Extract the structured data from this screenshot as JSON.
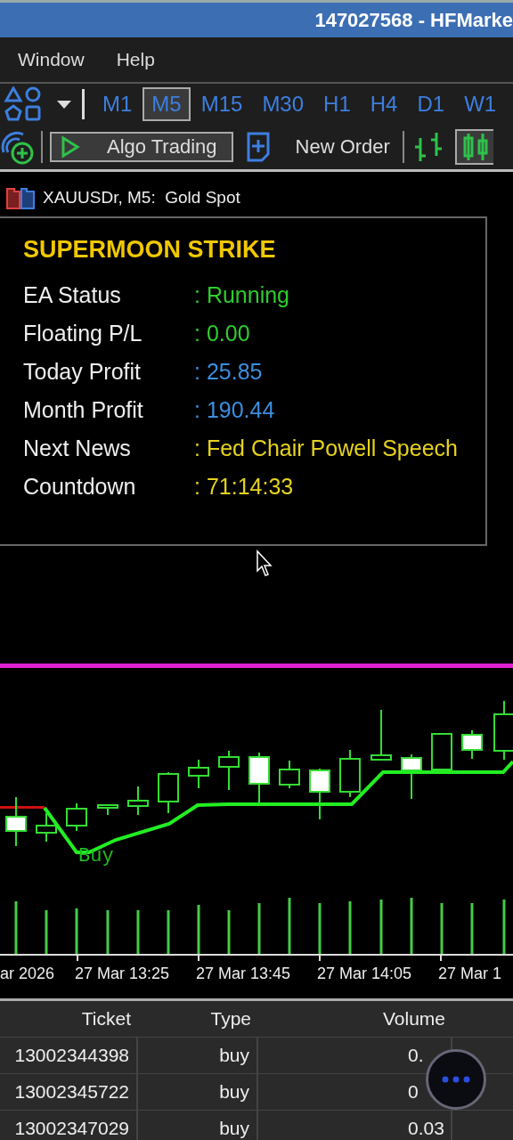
{
  "window": {
    "title": "147027568 - HFMarke"
  },
  "menu": [
    {
      "label": "Window"
    },
    {
      "label": "Help"
    }
  ],
  "timeframes": [
    {
      "label": "M1",
      "selected": false
    },
    {
      "label": "M5",
      "selected": true
    },
    {
      "label": "M15",
      "selected": false
    },
    {
      "label": "M30",
      "selected": false
    },
    {
      "label": "H1",
      "selected": false
    },
    {
      "label": "H4",
      "selected": false
    },
    {
      "label": "D1",
      "selected": false
    },
    {
      "label": "W1",
      "selected": false
    }
  ],
  "toolbar": {
    "algo_trading": "Algo Trading",
    "new_order": "New Order"
  },
  "chart_tab": {
    "title": "XAUUSDr, M5:  Gold Spot"
  },
  "panel": {
    "title": "SUPERMOON STRIKE",
    "rows": [
      {
        "label": "EA Status",
        "value": ": Running",
        "color": "#2ecc2e"
      },
      {
        "label": "Floating P/L",
        "value": ": 0.00",
        "color": "#2ecc2e"
      },
      {
        "label": "Today Profit",
        "value": ": 25.85",
        "color": "#3d8fe0"
      },
      {
        "label": "Month Profit",
        "value": ": 190.44",
        "color": "#3d8fe0"
      },
      {
        "label": "Next News",
        "value": ": Fed Chair Powell Speech",
        "color": "#e6d21e"
      },
      {
        "label": "Countdown",
        "value": ": 71:14:33",
        "color": "#e6d21e"
      }
    ]
  },
  "chart": {
    "signal_label": "Buy",
    "time_labels": [
      "ar 2026",
      "27 Mar 13:25",
      "27 Mar 13:45",
      "27 Mar 14:05",
      "27 Mar 1"
    ]
  },
  "table": {
    "columns": [
      "Ticket",
      "Type",
      "Volume"
    ],
    "rows": [
      {
        "ticket": "13002344398",
        "type": "buy",
        "volume": "0."
      },
      {
        "ticket": "13002345722",
        "type": "buy",
        "volume": "0"
      },
      {
        "ticket": "13002347029",
        "type": "buy",
        "volume": "0.03"
      }
    ]
  }
}
